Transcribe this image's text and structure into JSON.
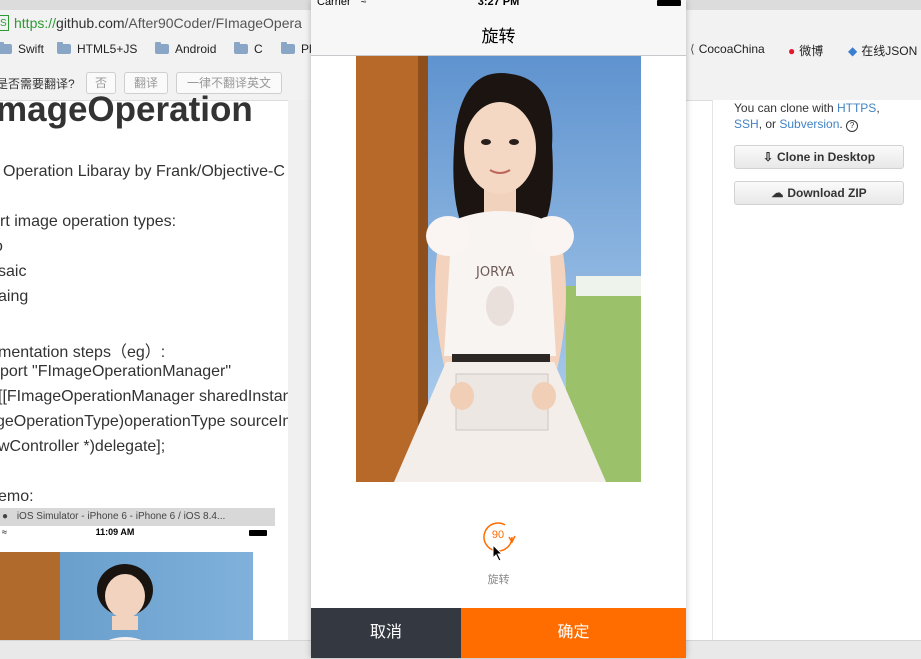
{
  "browser": {
    "url_scheme": "https://",
    "url_host": "github.com",
    "url_path": "/After90Coder/FImageOpera",
    "lock_label": "S",
    "bookmarks": [
      "Swift",
      "HTML5+JS",
      "Android",
      "C",
      "Pl",
      "CocoaChina",
      "微博",
      "在线JSON"
    ]
  },
  "translate_bar": {
    "prompt": "是否需要翻译?",
    "no": "否",
    "translate": "翻译",
    "never": "一律不翻译英文"
  },
  "readme": {
    "title": "mageOperation",
    "lines": [
      "Operation Libaray by Frank/Objective-C",
      "rt image operation types:",
      "o",
      "saic",
      "aing",
      "mentation steps（eg）:",
      "port \"FImageOperationManager\"",
      " [[FImageOperationManager sharedInstance",
      "geOperationType)operationType sourceImag",
      "wController *)delegate];",
      "emo:"
    ],
    "mini_sim_title": "iOS Simulator - iPhone 6 - iPhone 6 / iOS 8.4...",
    "mini_sim_time": "11:09 AM"
  },
  "sidebar": {
    "clone_prefix": "You can clone with ",
    "https": "HTTPS",
    "comma": ",",
    "ssh": "SSH",
    "or": ", or ",
    "subversion": "Subversion",
    "period": ".",
    "help": "?",
    "clone_desktop": "Clone in Desktop",
    "download_zip": "Download ZIP"
  },
  "simulator": {
    "carrier": "Carrier",
    "time": "3:27 PM",
    "nav_title": "旋转",
    "rotate_value": "90",
    "rotate_label": "旋转",
    "cancel": "取消",
    "confirm": "确定"
  },
  "colors": {
    "accent": "#ff6c00",
    "dark_button": "#343841",
    "link": "#4183c4"
  }
}
